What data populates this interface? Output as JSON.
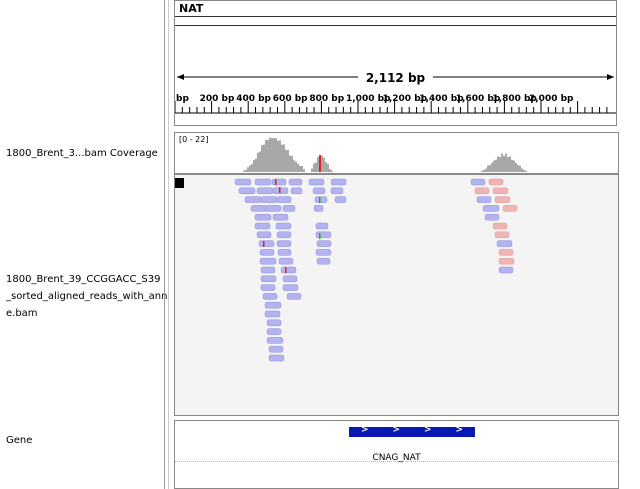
{
  "ruler": {
    "chromosome": "NAT",
    "span_label": "2,112 bp",
    "ticks": [
      "bp",
      "200 bp",
      "400 bp",
      "600 bp",
      "800 bp",
      "1,000 bp",
      "1,200 bp",
      "1,400 bp",
      "1,600 bp",
      "1,800 bp",
      "2,000 bp"
    ]
  },
  "tracks": {
    "coverage_name": "1800_Brent_3...bam Coverage",
    "coverage_range": "[0 - 22]",
    "alignment_name_lines": [
      "1800_Brent_39_CCGGACC_S39",
      "_sorted_aligned_reads_with_ann",
      "e.bam"
    ],
    "gene_name": "Gene"
  },
  "gene": {
    "feature_label": "CNAG_NAT",
    "strand_glyphs": [
      ">",
      ">",
      ">",
      ">"
    ]
  },
  "colors": {
    "read_forward": "#b3b3f0",
    "read_reverse": "#f0b4b4",
    "coverage": "#a8a8a8",
    "gene_feature": "#0a19b4",
    "mismatch_red": "#d22",
    "mismatch_green": "#2a2"
  }
}
